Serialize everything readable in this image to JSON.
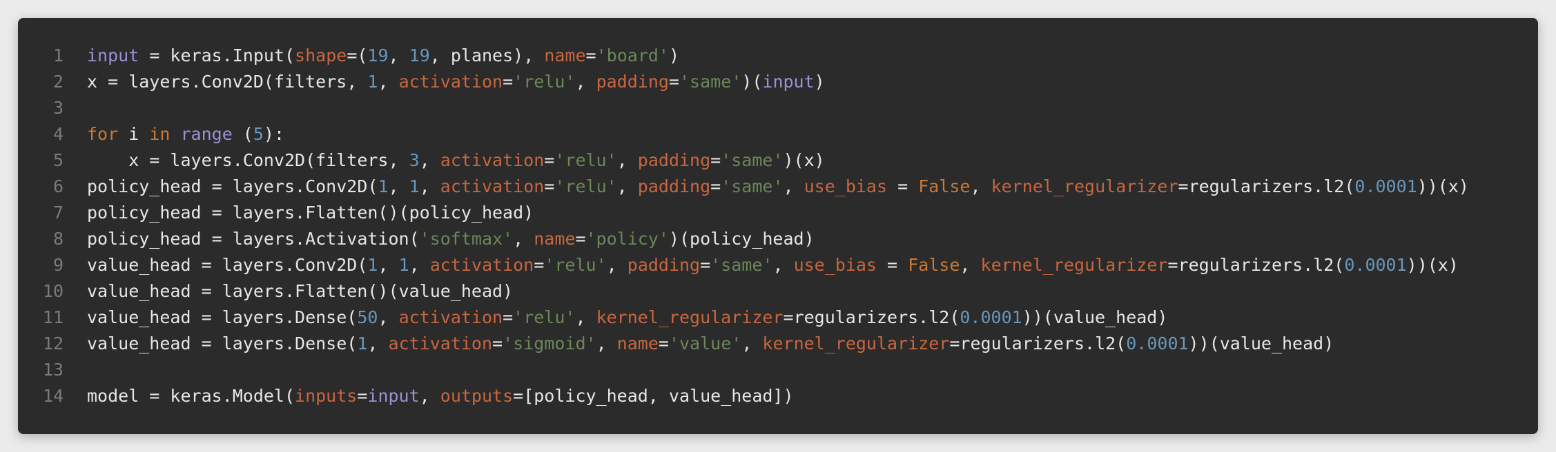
{
  "colors": {
    "background": "#2b2b2b",
    "page": "#ebebeb",
    "plain": "#e6e6e6",
    "keyword": "#cc7832",
    "builtin": "#9d8fd6",
    "parameter": "#c8663f",
    "number": "#6897bb",
    "string": "#6a8759",
    "line_number": "#7a7a7a"
  },
  "lines": [
    {
      "n": "1",
      "tokens": [
        {
          "t": "input",
          "k": "bi"
        },
        {
          "t": " = keras.Input(",
          "k": "plain"
        },
        {
          "t": "shape",
          "k": "param"
        },
        {
          "t": "=(",
          "k": "plain"
        },
        {
          "t": "19",
          "k": "num"
        },
        {
          "t": ", ",
          "k": "plain"
        },
        {
          "t": "19",
          "k": "num"
        },
        {
          "t": ", planes), ",
          "k": "plain"
        },
        {
          "t": "name",
          "k": "param"
        },
        {
          "t": "=",
          "k": "plain"
        },
        {
          "t": "'board'",
          "k": "str"
        },
        {
          "t": ")",
          "k": "plain"
        }
      ]
    },
    {
      "n": "2",
      "tokens": [
        {
          "t": "x = layers.Conv2D(filters, ",
          "k": "plain"
        },
        {
          "t": "1",
          "k": "num"
        },
        {
          "t": ", ",
          "k": "plain"
        },
        {
          "t": "activation",
          "k": "param"
        },
        {
          "t": "=",
          "k": "plain"
        },
        {
          "t": "'relu'",
          "k": "str"
        },
        {
          "t": ", ",
          "k": "plain"
        },
        {
          "t": "padding",
          "k": "param"
        },
        {
          "t": "=",
          "k": "plain"
        },
        {
          "t": "'same'",
          "k": "str"
        },
        {
          "t": ")(",
          "k": "plain"
        },
        {
          "t": "input",
          "k": "bi"
        },
        {
          "t": ")",
          "k": "plain"
        }
      ]
    },
    {
      "n": "3",
      "tokens": []
    },
    {
      "n": "4",
      "tokens": [
        {
          "t": "for",
          "k": "kw"
        },
        {
          "t": " i ",
          "k": "plain"
        },
        {
          "t": "in",
          "k": "kw"
        },
        {
          "t": " ",
          "k": "plain"
        },
        {
          "t": "range",
          "k": "bi"
        },
        {
          "t": " (",
          "k": "plain"
        },
        {
          "t": "5",
          "k": "num"
        },
        {
          "t": "):",
          "k": "plain"
        }
      ]
    },
    {
      "n": "5",
      "tokens": [
        {
          "t": "    x = layers.Conv2D(filters, ",
          "k": "plain"
        },
        {
          "t": "3",
          "k": "num"
        },
        {
          "t": ", ",
          "k": "plain"
        },
        {
          "t": "activation",
          "k": "param"
        },
        {
          "t": "=",
          "k": "plain"
        },
        {
          "t": "'relu'",
          "k": "str"
        },
        {
          "t": ", ",
          "k": "plain"
        },
        {
          "t": "padding",
          "k": "param"
        },
        {
          "t": "=",
          "k": "plain"
        },
        {
          "t": "'same'",
          "k": "str"
        },
        {
          "t": ")(x)",
          "k": "plain"
        }
      ]
    },
    {
      "n": "6",
      "tokens": [
        {
          "t": "policy_head = layers.Conv2D(",
          "k": "plain"
        },
        {
          "t": "1",
          "k": "num"
        },
        {
          "t": ", ",
          "k": "plain"
        },
        {
          "t": "1",
          "k": "num"
        },
        {
          "t": ", ",
          "k": "plain"
        },
        {
          "t": "activation",
          "k": "param"
        },
        {
          "t": "=",
          "k": "plain"
        },
        {
          "t": "'relu'",
          "k": "str"
        },
        {
          "t": ", ",
          "k": "plain"
        },
        {
          "t": "padding",
          "k": "param"
        },
        {
          "t": "=",
          "k": "plain"
        },
        {
          "t": "'same'",
          "k": "str"
        },
        {
          "t": ", ",
          "k": "plain"
        },
        {
          "t": "use_bias",
          "k": "param"
        },
        {
          "t": " = ",
          "k": "plain"
        },
        {
          "t": "False",
          "k": "bool"
        },
        {
          "t": ", ",
          "k": "plain"
        },
        {
          "t": "kernel_regularizer",
          "k": "param"
        },
        {
          "t": "=regularizers.l2(",
          "k": "plain"
        },
        {
          "t": "0.0001",
          "k": "num"
        },
        {
          "t": "))(x)",
          "k": "plain"
        }
      ]
    },
    {
      "n": "7",
      "tokens": [
        {
          "t": "policy_head = layers.Flatten()(policy_head)",
          "k": "plain"
        }
      ]
    },
    {
      "n": "8",
      "tokens": [
        {
          "t": "policy_head = layers.Activation(",
          "k": "plain"
        },
        {
          "t": "'softmax'",
          "k": "str"
        },
        {
          "t": ", ",
          "k": "plain"
        },
        {
          "t": "name",
          "k": "param"
        },
        {
          "t": "=",
          "k": "plain"
        },
        {
          "t": "'policy'",
          "k": "str"
        },
        {
          "t": ")(policy_head)",
          "k": "plain"
        }
      ]
    },
    {
      "n": "9",
      "tokens": [
        {
          "t": "value_head = layers.Conv2D(",
          "k": "plain"
        },
        {
          "t": "1",
          "k": "num"
        },
        {
          "t": ", ",
          "k": "plain"
        },
        {
          "t": "1",
          "k": "num"
        },
        {
          "t": ", ",
          "k": "plain"
        },
        {
          "t": "activation",
          "k": "param"
        },
        {
          "t": "=",
          "k": "plain"
        },
        {
          "t": "'relu'",
          "k": "str"
        },
        {
          "t": ", ",
          "k": "plain"
        },
        {
          "t": "padding",
          "k": "param"
        },
        {
          "t": "=",
          "k": "plain"
        },
        {
          "t": "'same'",
          "k": "str"
        },
        {
          "t": ", ",
          "k": "plain"
        },
        {
          "t": "use_bias",
          "k": "param"
        },
        {
          "t": " = ",
          "k": "plain"
        },
        {
          "t": "False",
          "k": "bool"
        },
        {
          "t": ", ",
          "k": "plain"
        },
        {
          "t": "kernel_regularizer",
          "k": "param"
        },
        {
          "t": "=regularizers.l2(",
          "k": "plain"
        },
        {
          "t": "0.0001",
          "k": "num"
        },
        {
          "t": "))(x)",
          "k": "plain"
        }
      ]
    },
    {
      "n": "10",
      "tokens": [
        {
          "t": "value_head = layers.Flatten()(value_head)",
          "k": "plain"
        }
      ]
    },
    {
      "n": "11",
      "tokens": [
        {
          "t": "value_head = layers.Dense(",
          "k": "plain"
        },
        {
          "t": "50",
          "k": "num"
        },
        {
          "t": ", ",
          "k": "plain"
        },
        {
          "t": "activation",
          "k": "param"
        },
        {
          "t": "=",
          "k": "plain"
        },
        {
          "t": "'relu'",
          "k": "str"
        },
        {
          "t": ", ",
          "k": "plain"
        },
        {
          "t": "kernel_regularizer",
          "k": "param"
        },
        {
          "t": "=regularizers.l2(",
          "k": "plain"
        },
        {
          "t": "0.0001",
          "k": "num"
        },
        {
          "t": "))(value_head)",
          "k": "plain"
        }
      ]
    },
    {
      "n": "12",
      "tokens": [
        {
          "t": "value_head = layers.Dense(",
          "k": "plain"
        },
        {
          "t": "1",
          "k": "num"
        },
        {
          "t": ", ",
          "k": "plain"
        },
        {
          "t": "activation",
          "k": "param"
        },
        {
          "t": "=",
          "k": "plain"
        },
        {
          "t": "'sigmoid'",
          "k": "str"
        },
        {
          "t": ", ",
          "k": "plain"
        },
        {
          "t": "name",
          "k": "param"
        },
        {
          "t": "=",
          "k": "plain"
        },
        {
          "t": "'value'",
          "k": "str"
        },
        {
          "t": ", ",
          "k": "plain"
        },
        {
          "t": "kernel_regularizer",
          "k": "param"
        },
        {
          "t": "=regularizers.l2(",
          "k": "plain"
        },
        {
          "t": "0.0001",
          "k": "num"
        },
        {
          "t": "))(value_head)",
          "k": "plain"
        }
      ]
    },
    {
      "n": "13",
      "tokens": []
    },
    {
      "n": "14",
      "tokens": [
        {
          "t": "model = keras.Model(",
          "k": "plain"
        },
        {
          "t": "inputs",
          "k": "param"
        },
        {
          "t": "=",
          "k": "plain"
        },
        {
          "t": "input",
          "k": "bi"
        },
        {
          "t": ", ",
          "k": "plain"
        },
        {
          "t": "outputs",
          "k": "param"
        },
        {
          "t": "=[policy_head, value_head])",
          "k": "plain"
        }
      ]
    }
  ]
}
